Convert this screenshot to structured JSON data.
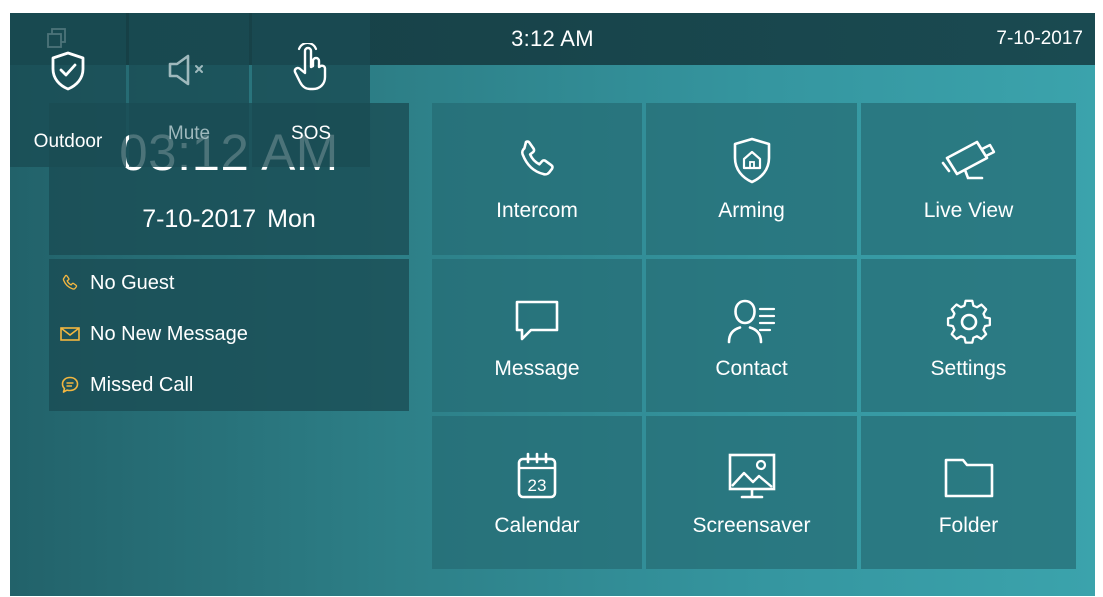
{
  "statusbar": {
    "time": "3:12 AM",
    "date": "7-10-2017",
    "left_icon": "window-restore-icon"
  },
  "clock": {
    "time": "03:12 AM",
    "date": "7-10-2017",
    "weekday": "Mon"
  },
  "status": {
    "items": [
      {
        "label": "No Guest",
        "icon": "phone-icon",
        "color": "#f2b640"
      },
      {
        "label": "No New Message",
        "icon": "envelope-icon",
        "color": "#f2b640"
      },
      {
        "label": "Missed Call",
        "icon": "chat-bubble-icon",
        "color": "#f2b640"
      }
    ]
  },
  "quick": {
    "outdoor": {
      "label": "Outdoor",
      "icon": "shield-check-icon"
    },
    "mute": {
      "label": "Mute",
      "icon": "speaker-mute-icon",
      "disabled": true
    },
    "sos": {
      "label": "SOS",
      "icon": "hand-pointer-icon"
    }
  },
  "tiles": [
    {
      "label": "Intercom",
      "icon": "phone-icon"
    },
    {
      "label": "Arming",
      "icon": "shield-home-icon"
    },
    {
      "label": "Live View",
      "icon": "security-camera-icon"
    },
    {
      "label": "Message",
      "icon": "speech-bubble-icon"
    },
    {
      "label": "Contact",
      "icon": "contact-list-icon"
    },
    {
      "label": "Settings",
      "icon": "gear-icon"
    },
    {
      "label": "Calendar",
      "icon": "calendar-icon",
      "day": "23"
    },
    {
      "label": "Screensaver",
      "icon": "picture-monitor-icon"
    },
    {
      "label": "Folder",
      "icon": "folder-icon"
    }
  ],
  "colors": {
    "accent": "#f2b640",
    "disabled_text": "#9fb9bd",
    "statusbar_bg": "#173f45"
  }
}
